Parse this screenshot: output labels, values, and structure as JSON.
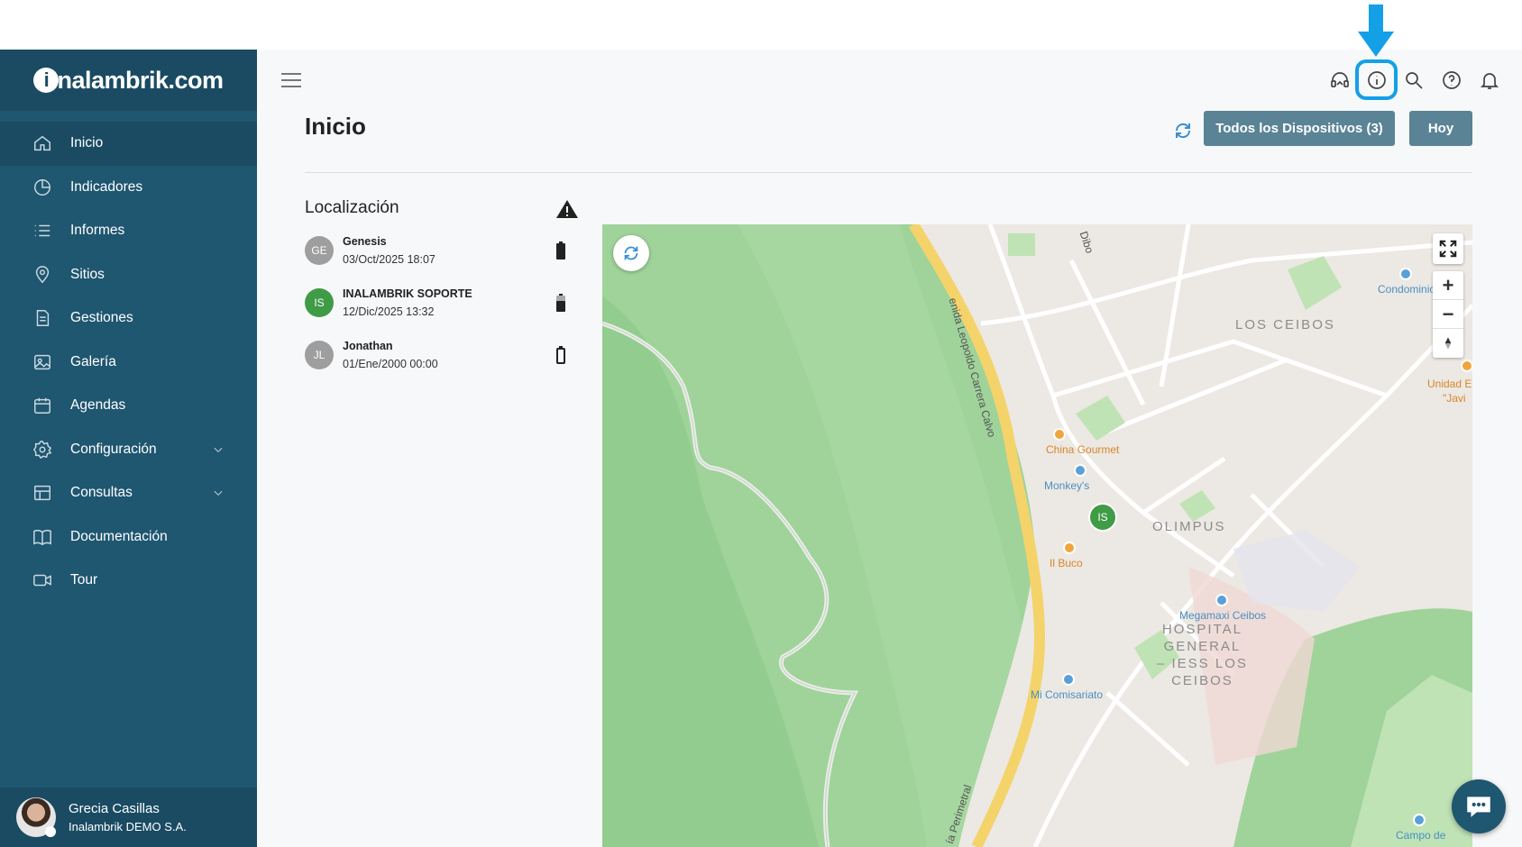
{
  "brand": {
    "logo_text": "inalambrik.com",
    "logo_letter": "i",
    "logo_rest": "nalambrik.com"
  },
  "sidebar": {
    "items": [
      {
        "label": "Inicio",
        "icon": "home-icon",
        "active": true
      },
      {
        "label": "Indicadores",
        "icon": "pie-chart-icon"
      },
      {
        "label": "Informes",
        "icon": "list-icon"
      },
      {
        "label": "Sitios",
        "icon": "location-pin-icon"
      },
      {
        "label": "Gestiones",
        "icon": "document-icon"
      },
      {
        "label": "Galería",
        "icon": "image-icon"
      },
      {
        "label": "Agendas",
        "icon": "calendar-icon"
      },
      {
        "label": "Configuración",
        "icon": "gear-icon",
        "expandable": true
      },
      {
        "label": "Consultas",
        "icon": "table-icon",
        "expandable": true
      },
      {
        "label": "Documentación",
        "icon": "book-icon"
      },
      {
        "label": "Tour",
        "icon": "video-icon"
      }
    ]
  },
  "user": {
    "name": "Grecia Casillas",
    "company": "Inalambrik DEMO S.A."
  },
  "topbar": {
    "icons": [
      "headset-icon",
      "info-icon",
      "search-icon",
      "help-icon",
      "bell-icon"
    ],
    "highlight_color": "#14a0e6"
  },
  "header": {
    "title": "Inicio",
    "devices_button": "Todos los Dispositivos (3)",
    "today_button": "Hoy"
  },
  "location": {
    "title": "Localización",
    "devices": [
      {
        "initials": "GE",
        "name": "Genesis",
        "time": "03/Oct/2025 18:07",
        "color": "#9e9e9e",
        "battery": "medium"
      },
      {
        "initials": "IS",
        "name": "INALAMBRIK SOPORTE",
        "time": "12/Dic/2025 13:32",
        "color": "#3f9b46",
        "battery": "medium"
      },
      {
        "initials": "JL",
        "name": "Jonathan",
        "time": "01/Ene/2000 00:00",
        "color": "#9e9e9e",
        "battery": "empty"
      }
    ]
  },
  "map": {
    "marker": "IS",
    "labels": {
      "los_ceibos": "LOS CEIBOS",
      "olimpus": "OLIMPUS",
      "hospital": [
        "HOSPITAL",
        "GENERAL",
        "– IESS LOS",
        "CEIBOS"
      ],
      "china": "China Gourmet",
      "monkey": "Monkey's",
      "ilbuco": "Il Buco",
      "megamaxi": "Megamaxi Ceibos",
      "comisariato": "Mi Comisariato",
      "condominio": "Condominio",
      "unidad": "Unidad E",
      "javi": "\"Javi",
      "campo": "Campo de",
      "road_leopoldo": "enida Leopoldo Carrera Calvo",
      "road_dibo": "Dibo",
      "road_perimetral": "ía Perimetral"
    },
    "zoom_in": "+",
    "zoom_out": "−"
  }
}
